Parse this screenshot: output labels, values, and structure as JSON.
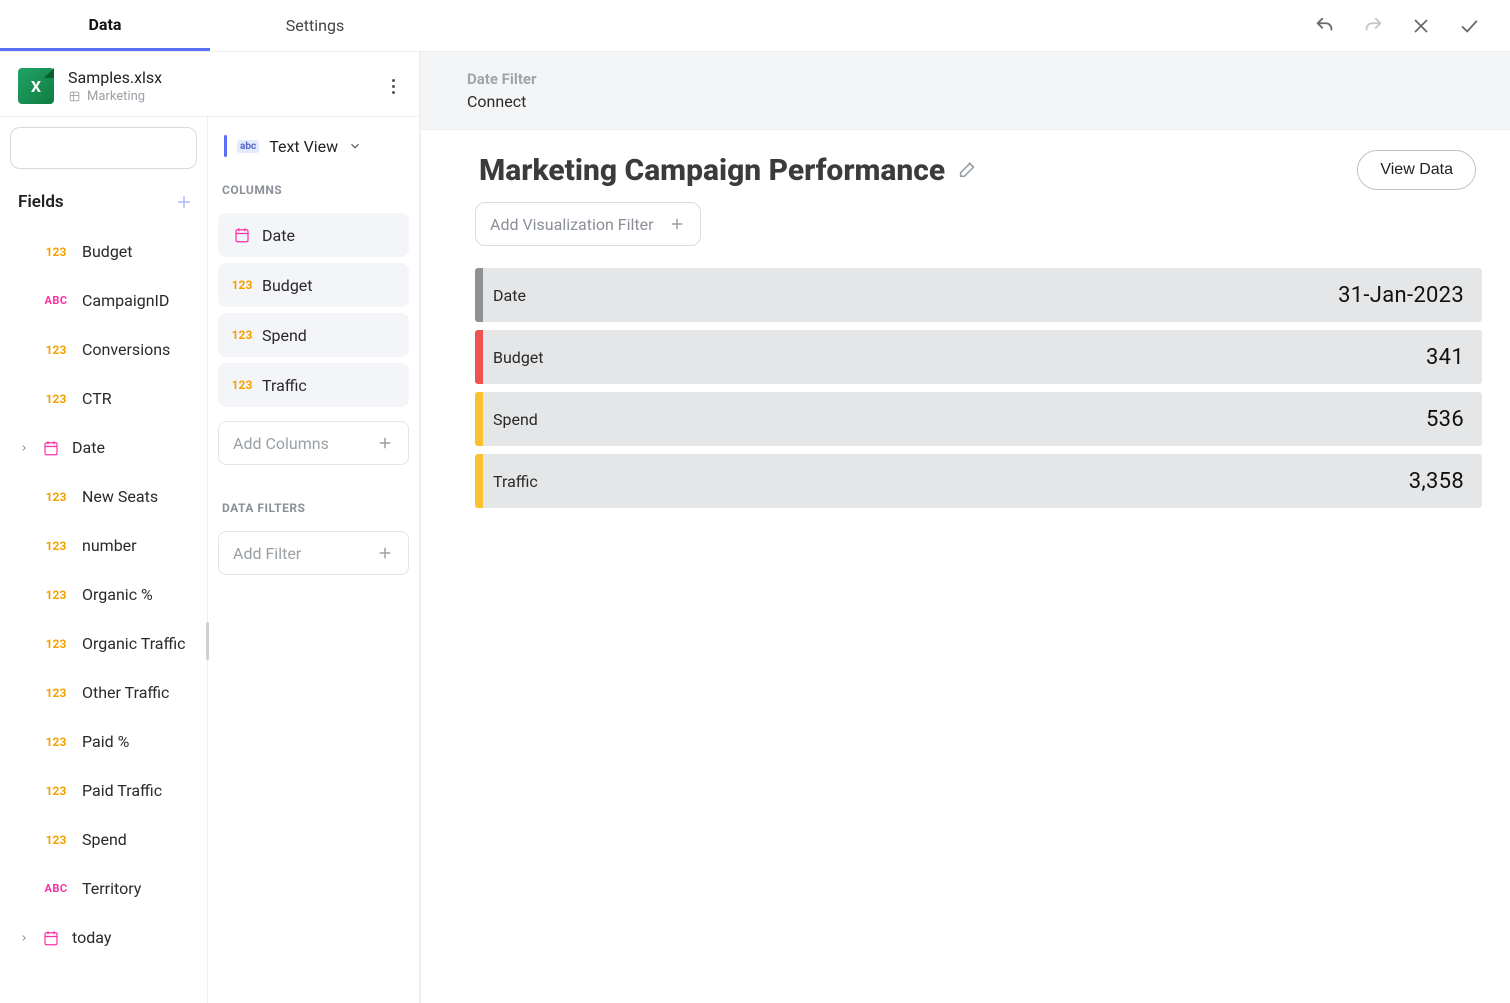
{
  "tabs": {
    "data": "Data",
    "settings": "Settings"
  },
  "file": {
    "name": "Samples.xlsx",
    "sheet": "Marketing"
  },
  "search": {
    "placeholder": ""
  },
  "fields_label": "Fields",
  "fields": [
    {
      "type": "123",
      "label": "Budget"
    },
    {
      "type": "abc",
      "label": "CampaignID"
    },
    {
      "type": "123",
      "label": "Conversions"
    },
    {
      "type": "123",
      "label": "CTR"
    },
    {
      "type": "date",
      "label": "Date",
      "expandable": true
    },
    {
      "type": "123",
      "label": "New Seats"
    },
    {
      "type": "123",
      "label": "number"
    },
    {
      "type": "123",
      "label": "Organic %"
    },
    {
      "type": "123",
      "label": "Organic Traffic"
    },
    {
      "type": "123",
      "label": "Other Traffic"
    },
    {
      "type": "123",
      "label": "Paid %"
    },
    {
      "type": "123",
      "label": "Paid Traffic"
    },
    {
      "type": "123",
      "label": "Spend"
    },
    {
      "type": "abc",
      "label": "Territory"
    },
    {
      "type": "date",
      "label": "today",
      "expandable": true
    }
  ],
  "viz_type": {
    "badge": "abc",
    "label": "Text View"
  },
  "columns_label": "COLUMNS",
  "columns": [
    {
      "type": "date",
      "label": "Date"
    },
    {
      "type": "123",
      "label": "Budget"
    },
    {
      "type": "123",
      "label": "Spend"
    },
    {
      "type": "123",
      "label": "Traffic"
    }
  ],
  "add_columns_placeholder": "Add Columns",
  "filters_label": "DATA FILTERS",
  "add_filter_placeholder": "Add Filter",
  "ribbon": {
    "head": "Date Filter",
    "val": "Connect"
  },
  "viz_title": "Marketing Campaign Performance",
  "viz_filter_placeholder": "Add Visualization Filter",
  "view_data_btn": "View Data",
  "rows": [
    {
      "key": "Date",
      "val": "31-Jan-2023",
      "color": "gray"
    },
    {
      "key": "Budget",
      "val": "341",
      "color": "red"
    },
    {
      "key": "Spend",
      "val": "536",
      "color": "amber"
    },
    {
      "key": "Traffic",
      "val": "3,358",
      "color": "amber"
    }
  ],
  "chart_data": {
    "type": "table",
    "title": "Marketing Campaign Performance",
    "categories": [
      "Date",
      "Budget",
      "Spend",
      "Traffic"
    ],
    "values": [
      "31-Jan-2023",
      341,
      536,
      3358
    ]
  }
}
